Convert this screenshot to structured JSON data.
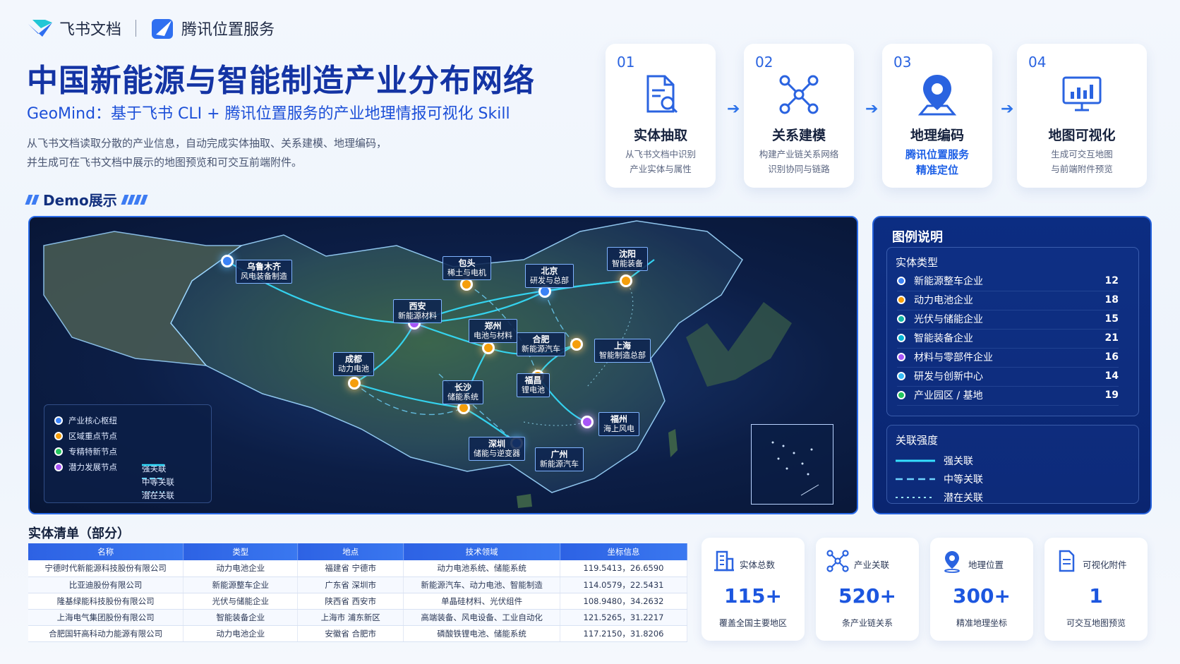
{
  "brand": {
    "feishu": "飞书文档",
    "tencent": "腾讯位置服务"
  },
  "header": {
    "title": "中国新能源与智能制造产业分布网络",
    "subtitle": "GeoMind：基于飞书 CLI + 腾讯位置服务的产业地理情报可视化 Skill",
    "desc_line1": "从飞书文档读取分散的产业信息，自动完成实体抽取、关系建模、地理编码，",
    "desc_line2": "并生成可在飞书文档中展示的地图预览和可交互前端附件。",
    "demo": "Demo展示"
  },
  "steps": [
    {
      "num": "01",
      "title": "实体抽取",
      "line1": "从飞书文档中识别",
      "line2": "产业实体与属性",
      "icon": "document-search-icon"
    },
    {
      "num": "02",
      "title": "关系建模",
      "line1": "构建产业链关系网络",
      "line2": "识别协同与链路",
      "icon": "network-icon"
    },
    {
      "num": "03",
      "title": "地理编码",
      "line1": "腾讯位置服务",
      "line2": "精准定位",
      "icon": "location-pin-icon"
    },
    {
      "num": "04",
      "title": "地图可视化",
      "line1": "生成可交互地图",
      "line2": "与前端附件预览",
      "icon": "monitor-chart-icon"
    }
  ],
  "map": {
    "cities": [
      {
        "name": "乌鲁木齐",
        "desc": "风电装备制造"
      },
      {
        "name": "包头",
        "desc": "稀土与电机"
      },
      {
        "name": "北京",
        "desc": "研发与总部"
      },
      {
        "name": "沈阳",
        "desc": "智能装备"
      },
      {
        "name": "西安",
        "desc": "新能源材料"
      },
      {
        "name": "郑州",
        "desc": "电池与材料"
      },
      {
        "name": "合肥",
        "desc": "新能源汽车"
      },
      {
        "name": "上海",
        "desc": "智能制造总部"
      },
      {
        "name": "成都",
        "desc": "动力电池"
      },
      {
        "name": "长沙",
        "desc": "储能系统"
      },
      {
        "name": "福昌",
        "desc": "锂电池"
      },
      {
        "name": "福州",
        "desc": "海上风电"
      },
      {
        "name": "深圳",
        "desc": "储能与逆变器"
      },
      {
        "name": "广州",
        "desc": "新能源汽车"
      }
    ],
    "legend_nodes": [
      "产业核心枢纽",
      "区域重点节点",
      "专精特新节点",
      "潜力发展节点"
    ],
    "legend_lines": [
      "强关联",
      "中等关联",
      "潜在关联"
    ],
    "colors": {
      "hub": "#3b82f6",
      "regional": "#f59e0b",
      "specialized": "#22c55e",
      "potential": "#a855f7",
      "link": "#35e0ff"
    }
  },
  "legend": {
    "title": "图例说明",
    "entity_title": "实体类型",
    "entities": [
      {
        "label": "新能源整车企业",
        "count": "12",
        "color": "#3b82f6"
      },
      {
        "label": "动力电池企业",
        "count": "18",
        "color": "#f59e0b"
      },
      {
        "label": "光伏与储能企业",
        "count": "15",
        "color": "#14b8a6"
      },
      {
        "label": "智能装备企业",
        "count": "21",
        "color": "#06b6d4"
      },
      {
        "label": "材料与零部件企业",
        "count": "16",
        "color": "#a855f7"
      },
      {
        "label": "研发与创新中心",
        "count": "14",
        "color": "#38bdf8"
      },
      {
        "label": "产业园区 / 基地",
        "count": "19",
        "color": "#22c55e"
      }
    ],
    "strength_title": "关联强度",
    "strengths": [
      "强关联",
      "中等关联",
      "潜在关联"
    ]
  },
  "table": {
    "title": "实体清单（部分）",
    "headers": [
      "名称",
      "类型",
      "地点",
      "技术领域",
      "坐标信息"
    ],
    "rows": [
      [
        "宁德时代新能源科技股份有限公司",
        "动力电池企业",
        "福建省  宁德市",
        "动力电池系统、储能系统",
        "119.5413，26.6590"
      ],
      [
        "比亚迪股份有限公司",
        "新能源整车企业",
        "广东省  深圳市",
        "新能源汽车、动力电池、智能制造",
        "114.0579，22.5431"
      ],
      [
        "隆基绿能科技股份有限公司",
        "光伏与储能企业",
        "陕西省  西安市",
        "单晶硅材料、光伏组件",
        "108.9480，34.2632"
      ],
      [
        "上海电气集团股份有限公司",
        "智能装备企业",
        "上海市  浦东新区",
        "高端装备、风电设备、工业自动化",
        "121.5265，31.2217"
      ],
      [
        "合肥国轩高科动力能源有限公司",
        "动力电池企业",
        "安徽省  合肥市",
        "磷酸铁锂电池、储能系统",
        "117.2150，31.8206"
      ]
    ]
  },
  "stats": [
    {
      "label": "实体总数",
      "value": "115+",
      "sub": "覆盖全国主要地区",
      "icon": "building-icon"
    },
    {
      "label": "产业关联",
      "value": "520+",
      "sub": "条产业链关系",
      "icon": "network-icon"
    },
    {
      "label": "地理位置",
      "value": "300+",
      "sub": "精准地理坐标",
      "icon": "location-pin-icon"
    },
    {
      "label": "可视化附件",
      "value": "1",
      "sub": "可交互地图预览",
      "icon": "document-icon"
    }
  ]
}
